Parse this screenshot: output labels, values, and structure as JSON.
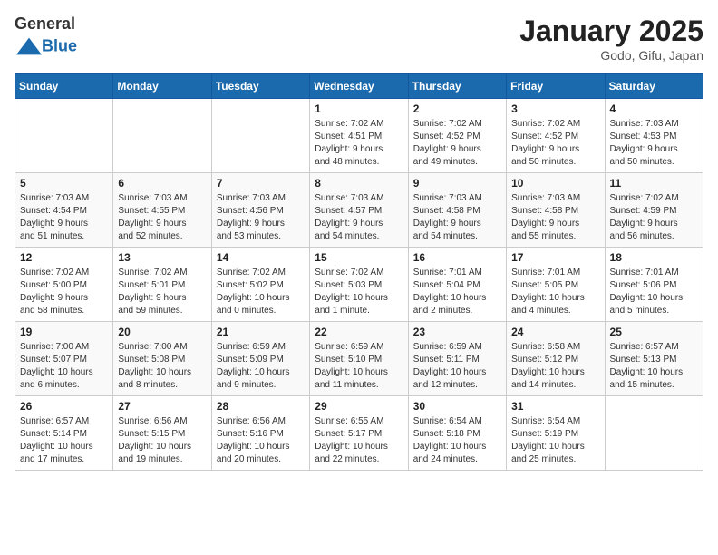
{
  "header": {
    "logo_general": "General",
    "logo_blue": "Blue",
    "month_title": "January 2025",
    "location": "Godo, Gifu, Japan"
  },
  "days_of_week": [
    "Sunday",
    "Monday",
    "Tuesday",
    "Wednesday",
    "Thursday",
    "Friday",
    "Saturday"
  ],
  "weeks": [
    [
      {
        "day": "",
        "info": ""
      },
      {
        "day": "",
        "info": ""
      },
      {
        "day": "",
        "info": ""
      },
      {
        "day": "1",
        "info": "Sunrise: 7:02 AM\nSunset: 4:51 PM\nDaylight: 9 hours\nand 48 minutes."
      },
      {
        "day": "2",
        "info": "Sunrise: 7:02 AM\nSunset: 4:52 PM\nDaylight: 9 hours\nand 49 minutes."
      },
      {
        "day": "3",
        "info": "Sunrise: 7:02 AM\nSunset: 4:52 PM\nDaylight: 9 hours\nand 50 minutes."
      },
      {
        "day": "4",
        "info": "Sunrise: 7:03 AM\nSunset: 4:53 PM\nDaylight: 9 hours\nand 50 minutes."
      }
    ],
    [
      {
        "day": "5",
        "info": "Sunrise: 7:03 AM\nSunset: 4:54 PM\nDaylight: 9 hours\nand 51 minutes."
      },
      {
        "day": "6",
        "info": "Sunrise: 7:03 AM\nSunset: 4:55 PM\nDaylight: 9 hours\nand 52 minutes."
      },
      {
        "day": "7",
        "info": "Sunrise: 7:03 AM\nSunset: 4:56 PM\nDaylight: 9 hours\nand 53 minutes."
      },
      {
        "day": "8",
        "info": "Sunrise: 7:03 AM\nSunset: 4:57 PM\nDaylight: 9 hours\nand 54 minutes."
      },
      {
        "day": "9",
        "info": "Sunrise: 7:03 AM\nSunset: 4:58 PM\nDaylight: 9 hours\nand 54 minutes."
      },
      {
        "day": "10",
        "info": "Sunrise: 7:03 AM\nSunset: 4:58 PM\nDaylight: 9 hours\nand 55 minutes."
      },
      {
        "day": "11",
        "info": "Sunrise: 7:02 AM\nSunset: 4:59 PM\nDaylight: 9 hours\nand 56 minutes."
      }
    ],
    [
      {
        "day": "12",
        "info": "Sunrise: 7:02 AM\nSunset: 5:00 PM\nDaylight: 9 hours\nand 58 minutes."
      },
      {
        "day": "13",
        "info": "Sunrise: 7:02 AM\nSunset: 5:01 PM\nDaylight: 9 hours\nand 59 minutes."
      },
      {
        "day": "14",
        "info": "Sunrise: 7:02 AM\nSunset: 5:02 PM\nDaylight: 10 hours\nand 0 minutes."
      },
      {
        "day": "15",
        "info": "Sunrise: 7:02 AM\nSunset: 5:03 PM\nDaylight: 10 hours\nand 1 minute."
      },
      {
        "day": "16",
        "info": "Sunrise: 7:01 AM\nSunset: 5:04 PM\nDaylight: 10 hours\nand 2 minutes."
      },
      {
        "day": "17",
        "info": "Sunrise: 7:01 AM\nSunset: 5:05 PM\nDaylight: 10 hours\nand 4 minutes."
      },
      {
        "day": "18",
        "info": "Sunrise: 7:01 AM\nSunset: 5:06 PM\nDaylight: 10 hours\nand 5 minutes."
      }
    ],
    [
      {
        "day": "19",
        "info": "Sunrise: 7:00 AM\nSunset: 5:07 PM\nDaylight: 10 hours\nand 6 minutes."
      },
      {
        "day": "20",
        "info": "Sunrise: 7:00 AM\nSunset: 5:08 PM\nDaylight: 10 hours\nand 8 minutes."
      },
      {
        "day": "21",
        "info": "Sunrise: 6:59 AM\nSunset: 5:09 PM\nDaylight: 10 hours\nand 9 minutes."
      },
      {
        "day": "22",
        "info": "Sunrise: 6:59 AM\nSunset: 5:10 PM\nDaylight: 10 hours\nand 11 minutes."
      },
      {
        "day": "23",
        "info": "Sunrise: 6:59 AM\nSunset: 5:11 PM\nDaylight: 10 hours\nand 12 minutes."
      },
      {
        "day": "24",
        "info": "Sunrise: 6:58 AM\nSunset: 5:12 PM\nDaylight: 10 hours\nand 14 minutes."
      },
      {
        "day": "25",
        "info": "Sunrise: 6:57 AM\nSunset: 5:13 PM\nDaylight: 10 hours\nand 15 minutes."
      }
    ],
    [
      {
        "day": "26",
        "info": "Sunrise: 6:57 AM\nSunset: 5:14 PM\nDaylight: 10 hours\nand 17 minutes."
      },
      {
        "day": "27",
        "info": "Sunrise: 6:56 AM\nSunset: 5:15 PM\nDaylight: 10 hours\nand 19 minutes."
      },
      {
        "day": "28",
        "info": "Sunrise: 6:56 AM\nSunset: 5:16 PM\nDaylight: 10 hours\nand 20 minutes."
      },
      {
        "day": "29",
        "info": "Sunrise: 6:55 AM\nSunset: 5:17 PM\nDaylight: 10 hours\nand 22 minutes."
      },
      {
        "day": "30",
        "info": "Sunrise: 6:54 AM\nSunset: 5:18 PM\nDaylight: 10 hours\nand 24 minutes."
      },
      {
        "day": "31",
        "info": "Sunrise: 6:54 AM\nSunset: 5:19 PM\nDaylight: 10 hours\nand 25 minutes."
      },
      {
        "day": "",
        "info": ""
      }
    ]
  ]
}
